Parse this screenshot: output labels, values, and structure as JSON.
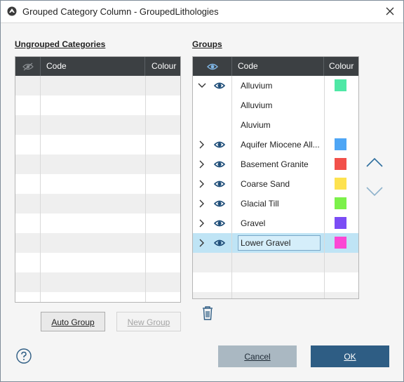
{
  "window": {
    "title": "Grouped Category Column - GroupedLithologies",
    "close_icon": "close-icon",
    "app_icon": "app-icon"
  },
  "ungrouped": {
    "label": "Ungrouped Categories",
    "columns": {
      "visibility_icon": "eye-slash-icon",
      "code": "Code",
      "colour": "Colour"
    },
    "rows": []
  },
  "groups": {
    "label": "Groups",
    "columns": {
      "visibility_icon": "eye-icon",
      "code": "Code",
      "colour": "Colour"
    },
    "rows": [
      {
        "expander": "chevron-down-icon",
        "visible": true,
        "code": "Alluvium",
        "colour": "#4fe8a6"
      },
      {
        "expander": "",
        "visible": false,
        "code": "Alluvium",
        "colour": ""
      },
      {
        "expander": "",
        "visible": false,
        "code": "Aluvium",
        "colour": ""
      },
      {
        "expander": "chevron-right-icon",
        "visible": true,
        "code": "Aquifer Miocene All...",
        "colour": "#4ea6f5"
      },
      {
        "expander": "chevron-right-icon",
        "visible": true,
        "code": "Basement Granite",
        "colour": "#f2504a"
      },
      {
        "expander": "chevron-right-icon",
        "visible": true,
        "code": "Coarse Sand",
        "colour": "#fde24f"
      },
      {
        "expander": "chevron-right-icon",
        "visible": true,
        "code": "Glacial Till",
        "colour": "#7cf14a"
      },
      {
        "expander": "chevron-right-icon",
        "visible": true,
        "code": "Gravel",
        "colour": "#7b4df5"
      },
      {
        "expander": "chevron-right-icon",
        "visible": true,
        "code": "Lower Gravel",
        "colour": "#fb47d4",
        "selected": true,
        "editing": true
      }
    ]
  },
  "buttons": {
    "auto_group": "Auto Group",
    "new_group": "New Group",
    "cancel": "Cancel",
    "ok": "OK"
  },
  "icons": {
    "move_up": "chevron-up-icon",
    "move_down": "chevron-down-icon",
    "delete": "trash-icon",
    "help": "help-icon"
  },
  "colors": {
    "accent": "#2e5d84",
    "header_bg": "#3c4043",
    "eye_color": "#1f4e79",
    "selection": "#bfe4f5"
  }
}
